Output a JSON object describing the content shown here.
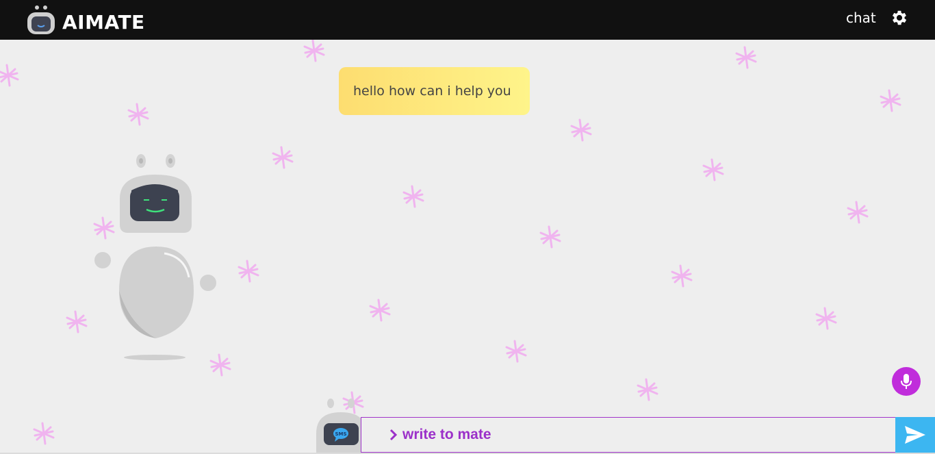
{
  "header": {
    "brand": "AIMATE",
    "nav_chat": "chat",
    "settings_icon": "gear-icon",
    "logo_icon": "robot-logo-icon"
  },
  "chat": {
    "messages": [
      {
        "from": "bot",
        "text": "hello how can i help you"
      }
    ]
  },
  "composer": {
    "placeholder": "write to mate",
    "send_icon": "send-icon",
    "mic_icon": "microphone-icon",
    "avatar_icon": "sms-robot-icon"
  },
  "colors": {
    "header_bg": "#111111",
    "page_bg": "#eeeeee",
    "bubble_start": "#fddd70",
    "bubble_end": "#fef48a",
    "accent_purple": "#9b30c9",
    "mic_bg": "#c02ddb",
    "send_bg": "#3cb6f1",
    "sparkle": "#f0b4ef"
  }
}
